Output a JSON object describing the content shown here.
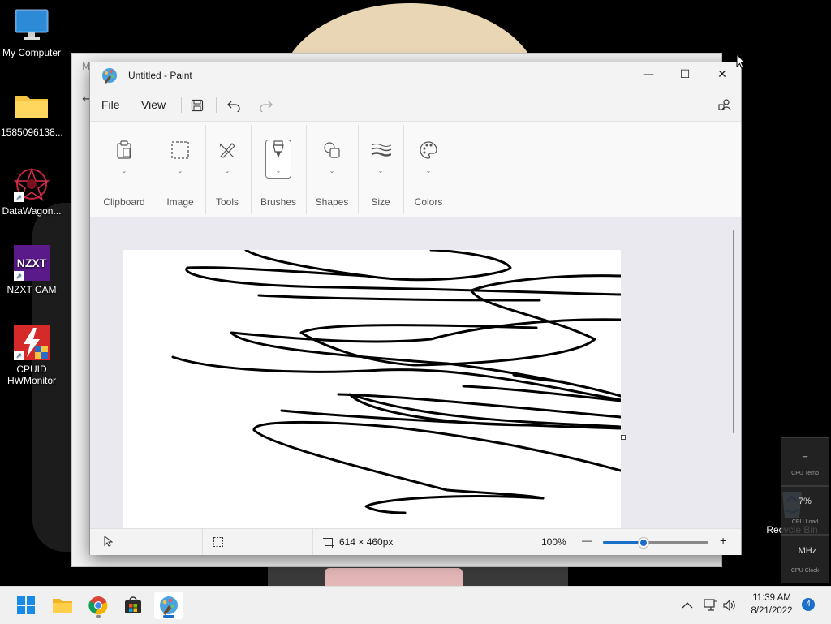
{
  "desktop": {
    "icons": [
      {
        "label": "My Computer",
        "icon": "monitor-icon"
      },
      {
        "label": "1585096138...",
        "icon": "folder-icon"
      },
      {
        "label": "DataWagon...",
        "icon": "datawagon-icon"
      },
      {
        "label": "NZXT CAM",
        "icon": "nzxt-icon",
        "badge": "NZXT"
      },
      {
        "label": "CPUID HWMonitor",
        "icon": "hwmonitor-icon"
      },
      {
        "label": "Recycle Bin",
        "icon": "recycle-bin-icon"
      }
    ]
  },
  "behind_window": {
    "title_initial": "M",
    "back": "←"
  },
  "paint": {
    "title": "Untitled - Paint",
    "window_controls": {
      "minimize": "—",
      "maximize": "☐",
      "close": "✕"
    },
    "menu": {
      "file": "File",
      "view": "View"
    },
    "ribbon": [
      {
        "label": "Clipboard",
        "icon": "clipboard-icon"
      },
      {
        "label": "Image",
        "icon": "image-select-icon"
      },
      {
        "label": "Tools",
        "icon": "tools-icon"
      },
      {
        "label": "Brushes",
        "icon": "brush-icon",
        "selected": true
      },
      {
        "label": "Shapes",
        "icon": "shapes-icon"
      },
      {
        "label": "Size",
        "icon": "size-icon"
      },
      {
        "label": "Colors",
        "icon": "palette-icon"
      }
    ],
    "status": {
      "canvas_size": "614 × 460px",
      "zoom": "100%",
      "zoom_out": "—",
      "zoom_in": "+",
      "zoom_level": 0.38
    }
  },
  "gadgets": [
    {
      "value": "_",
      "label": "CPU Temp"
    },
    {
      "value": "7%",
      "label": "CPU Load"
    },
    {
      "value": "⁻MHz",
      "label": "CPU Clock"
    }
  ],
  "taskbar": {
    "apps": [
      "start-icon",
      "file-explorer-icon",
      "chrome-icon",
      "store-icon",
      "paint-icon"
    ],
    "time": "11:39 AM",
    "date": "8/21/2022",
    "notifications": "4"
  },
  "colors": {
    "accent": "#1a6fc9",
    "ribbon_bg": "#f9f9f9",
    "workspace_bg": "#e9e9ef"
  }
}
